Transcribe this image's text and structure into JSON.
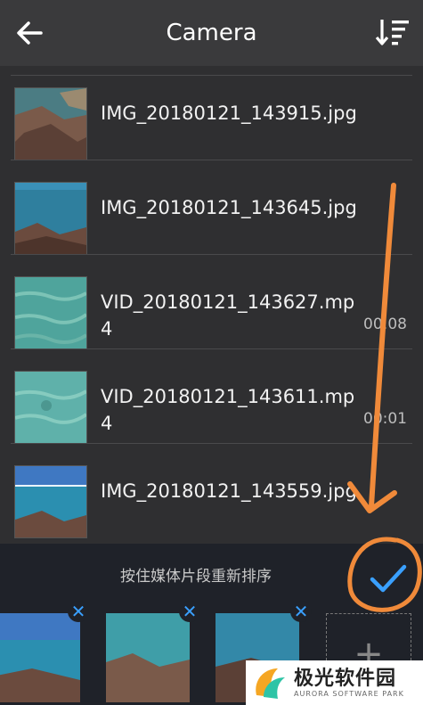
{
  "header": {
    "title": "Camera",
    "back_icon": "arrow-left-icon",
    "sort_icon": "sort-icon"
  },
  "files": [
    {
      "name": "IMG_20180121_143915.jpg",
      "duration": ""
    },
    {
      "name": "IMG_20180121_143645.jpg",
      "duration": ""
    },
    {
      "name": "VID_20180121_143627.mp4",
      "duration": "00:08"
    },
    {
      "name": "VID_20180121_143611.mp4",
      "duration": "00:01"
    },
    {
      "name": "IMG_20180121_143559.jpg",
      "duration": ""
    }
  ],
  "bottom": {
    "hint": "按住媒体片段重新排序",
    "confirm_icon": "check-icon",
    "remove_icon_glyph": "✕",
    "add_icon_glyph": "+"
  },
  "watermark": {
    "brand": "极光软件园",
    "sub": "AURORA SOFTWARE PARK"
  },
  "colors": {
    "accent": "#3aa0ff",
    "annotation": "#f08a3a",
    "background": "#2f2f31",
    "header": "#3a3a3c",
    "bottom_panel": "#1f2229"
  }
}
